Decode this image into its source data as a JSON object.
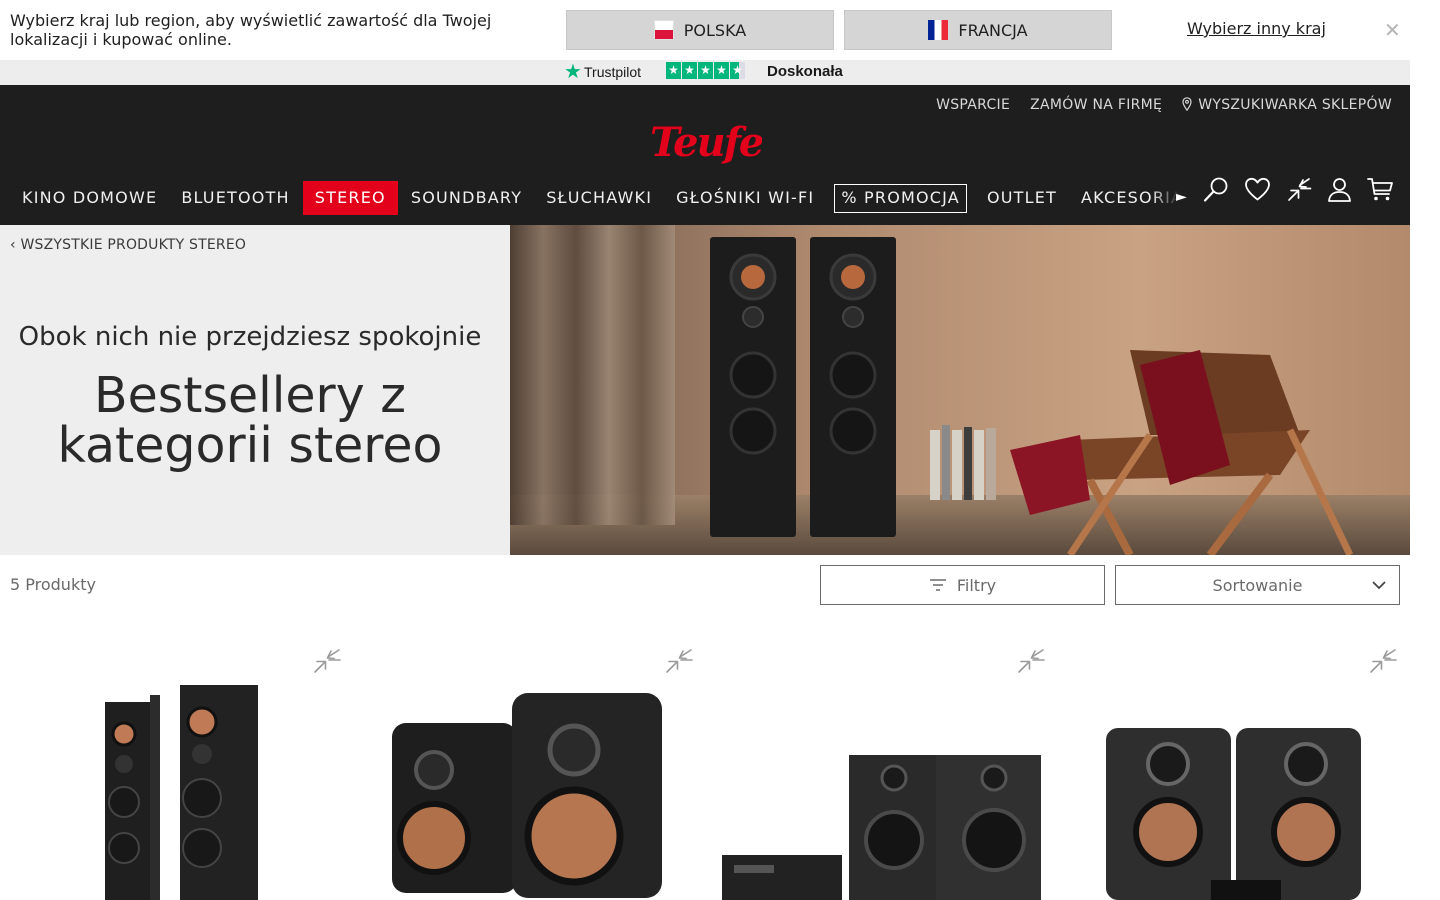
{
  "country_banner": {
    "message": "Wybierz kraj lub region, aby wyświetlić zawartość dla Twojej lokalizacji i kupować online.",
    "options": [
      {
        "label": "POLSKA",
        "flag": "flag-poland-icon"
      },
      {
        "label": "FRANCJA",
        "flag": "flag-france-icon"
      }
    ],
    "other_link": "Wybierz inny kraj",
    "close_icon": "close-icon"
  },
  "trustpilot": {
    "brand": "Trustpilot",
    "rating_label": "Doskonała",
    "stars": 4.5,
    "color": "#00b67a"
  },
  "header": {
    "util_links": {
      "support": "WSPARCIE",
      "business": "ZAMÓW NA FIRMĘ",
      "store_finder": "WYSZUKIWARKA SKLEPÓW"
    },
    "logo_text": "Teufel",
    "nav": [
      {
        "label": "KINO DOMOWE"
      },
      {
        "label": "BLUETOOTH"
      },
      {
        "label": "STEREO",
        "active": true
      },
      {
        "label": "SOUNDBARY"
      },
      {
        "label": "SŁUCHAWKI"
      },
      {
        "label": "GŁOŚNIKI WI-FI"
      },
      {
        "label": "% PROMOCJA"
      },
      {
        "label": "OUTLET"
      },
      {
        "label": "AKCESORIA"
      }
    ],
    "icons": [
      "search-icon",
      "heart-icon",
      "compare-icon",
      "user-icon",
      "cart-icon"
    ]
  },
  "hero": {
    "back_link": "WSZYSTKIE PRODUKTY STEREO",
    "subtitle": "Obok nich nie przejdziesz spokojnie",
    "title": "Bestsellery z kategorii stereo"
  },
  "toolbar": {
    "count": "5 Produkty",
    "filter_label": "Filtry",
    "sort_label": "Sortowanie"
  },
  "colors": {
    "brand_red": "#e2001a",
    "header_bg": "#1e1e1e",
    "trust_green": "#00b67a"
  }
}
